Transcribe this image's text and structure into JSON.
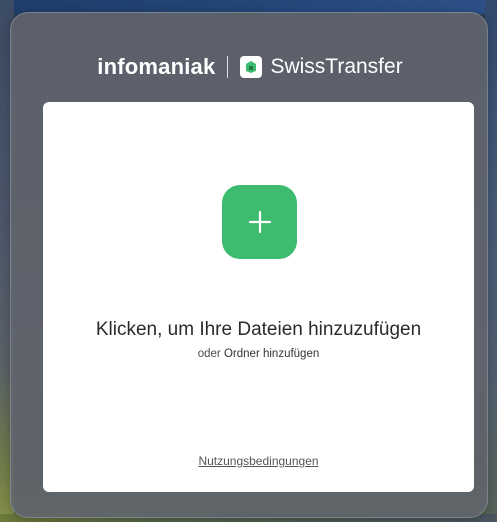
{
  "header": {
    "brand_left": "infomaniak",
    "brand_right": "SwissTransfer",
    "logo_icon": "swisstransfer-logo-icon"
  },
  "upload": {
    "add_icon": "plus-icon",
    "main_label": "Klicken, um Ihre Dateien hinzuzufügen",
    "sub_prefix": "oder",
    "sub_link": "Ordner hinzufügen"
  },
  "footer": {
    "terms_link": "Nutzungsbedingungen"
  },
  "colors": {
    "accent": "#3dbb6f",
    "panel": "#62656e",
    "card": "#ffffff"
  }
}
